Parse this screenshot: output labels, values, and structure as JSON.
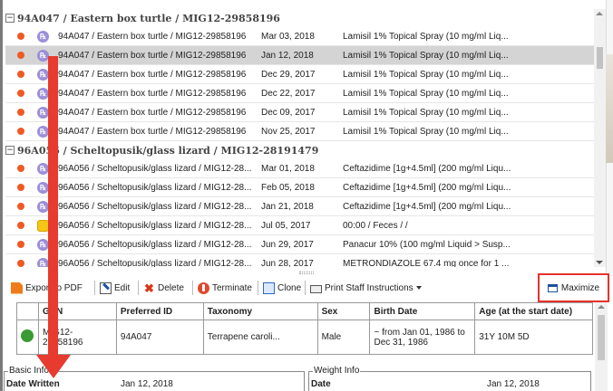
{
  "groups": [
    {
      "label": "94A047 / Eastern box turtle / MIG12-29858196",
      "rows": [
        {
          "icon": "rx",
          "animal": "94A047 / Eastern box turtle / MIG12-29858196",
          "date": "Mar 03, 2018",
          "desc": "Lamisil 1% Topical Spray (10 mg/ml Liq..."
        },
        {
          "icon": "rx",
          "animal": "94A047 / Eastern box turtle / MIG12-29858196",
          "date": "Jan 12, 2018",
          "desc": "Lamisil 1% Topical Spray (10 mg/ml Liq...",
          "selected": true
        },
        {
          "icon": "rx",
          "animal": "94A047 / Eastern box turtle / MIG12-29858196",
          "date": "Dec 29, 2017",
          "desc": "Lamisil 1% Topical Spray (10 mg/ml Liq..."
        },
        {
          "icon": "rx",
          "animal": "94A047 / Eastern box turtle / MIG12-29858196",
          "date": "Dec 22, 2017",
          "desc": "Lamisil 1% Topical Spray (10 mg/ml Liq..."
        },
        {
          "icon": "rx",
          "animal": "94A047 / Eastern box turtle / MIG12-29858196",
          "date": "Dec 09, 2017",
          "desc": "Lamisil 1% Topical Spray (10 mg/ml Liq..."
        },
        {
          "icon": "rx",
          "animal": "94A047 / Eastern box turtle / MIG12-29858196",
          "date": "Nov 25, 2017",
          "desc": "Lamisil 1% Topical Spray (10 mg/ml Liq..."
        }
      ]
    },
    {
      "label": "96A056 / Scheltopusik/glass lizard / MIG12-28191479",
      "rows": [
        {
          "icon": "rx",
          "animal": "96A056 / Scheltopusik/glass lizard / MIG12-28...",
          "date": "Mar 01, 2018",
          "desc": "Ceftazidime [1g+4.5ml] (200 mg/ml Liqu..."
        },
        {
          "icon": "rx",
          "animal": "96A056 / Scheltopusik/glass lizard / MIG12-28...",
          "date": "Feb 05, 2018",
          "desc": "Ceftazidime [1g+4.5ml] (200 mg/ml Liqu..."
        },
        {
          "icon": "rx",
          "animal": "96A056 / Scheltopusik/glass lizard / MIG12-28...",
          "date": "Jan 21, 2018",
          "desc": "Ceftazidime [1g+4.5ml] (200 mg/ml Liqu..."
        },
        {
          "icon": "sample",
          "animal": "96A056 / Scheltopusik/glass lizard / MIG12-28...",
          "date": "Jul 05, 2017",
          "desc": "00:00 / Feces / /"
        },
        {
          "icon": "rx",
          "animal": "96A056 / Scheltopusik/glass lizard / MIG12-28...",
          "date": "Jun 29, 2017",
          "desc": "Panacur 10% (100 mg/ml Liquid > Susp..."
        },
        {
          "icon": "rx",
          "animal": "96A056 / Scheltopusik/glass lizard / MIG12-28...",
          "date": "Jun 28, 2017",
          "desc": "METRONDIAZOLE 67.4 mg once for 1 ..."
        }
      ]
    }
  ],
  "toolbar": {
    "export": "Export to PDF",
    "edit": "Edit",
    "delete": "Delete",
    "terminate": "Terminate",
    "clone": "Clone",
    "print": "Print Staff Instructions",
    "maximize": "Maximize"
  },
  "detail": {
    "headers": {
      "gan": "GAN",
      "preferred_id": "Preferred ID",
      "taxonomy": "Taxonomy",
      "sex": "Sex",
      "birth_date": "Birth Date",
      "age": "Age (at the start date)"
    },
    "row": {
      "gan": "MIG12-29858196",
      "preferred_id": "94A047",
      "taxonomy": "Terrapene caroli...",
      "sex": "Male",
      "birth_date": "~ from Jan 01, 1986 to Dec 31, 1986",
      "age": "31Y 10M 5D"
    }
  },
  "basic_info": {
    "legend": "Basic Info",
    "label": "Date Written",
    "value": "Jan 12, 2018"
  },
  "weight_info": {
    "legend": "Weight Info",
    "label": "Date",
    "value": "Jan 12, 2018"
  },
  "icons": {
    "rx": "prescription-icon",
    "sample": "sample-jar-icon",
    "animal": "animal-icon"
  },
  "colors": {
    "status_dot": "#ee5a24",
    "rx_icon": "#9a8fd8",
    "annotation_red": "#e63b2e",
    "selected_row": "#d4d4d4"
  }
}
